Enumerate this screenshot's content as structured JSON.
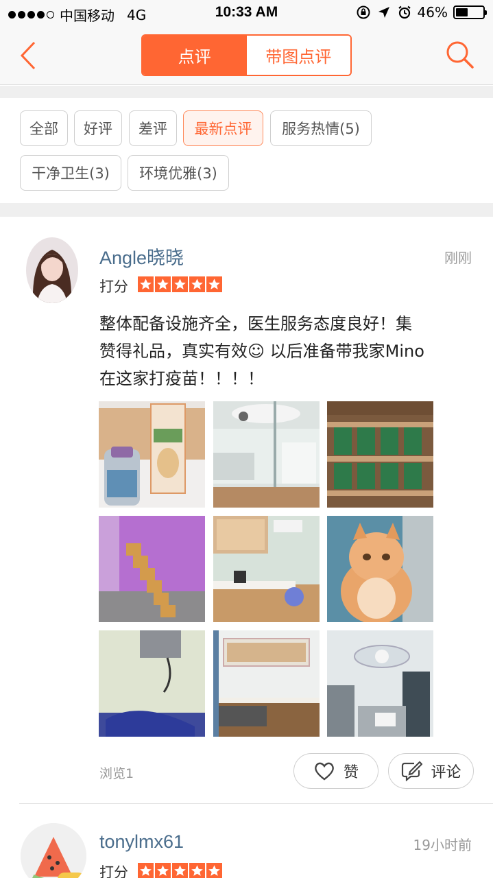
{
  "status_bar": {
    "carrier": "中国移动",
    "network": "4G",
    "time": "10:33 AM",
    "battery": "46%",
    "battery_level": 0.46
  },
  "nav": {
    "tabs": [
      {
        "label": "点评",
        "active": true
      },
      {
        "label": "带图点评",
        "active": false
      }
    ],
    "accent_color": "#ff6633"
  },
  "filters": [
    {
      "label": "全部",
      "active": false
    },
    {
      "label": "好评",
      "active": false
    },
    {
      "label": "差评",
      "active": false
    },
    {
      "label": "最新点评",
      "active": true
    },
    {
      "label": "服务热情(5)",
      "active": false
    },
    {
      "label": "干净卫生(3)",
      "active": false
    },
    {
      "label": "环境优雅(3)",
      "active": false
    }
  ],
  "reviews": [
    {
      "username": "Angle晓晓",
      "time": "刚刚",
      "rating_label": "打分",
      "rating": 5,
      "text_lines": [
        "整体配备设施齐全，医生服务态度良好！集",
        "赞得礼品，真实有效☺ 以后准备带我家Mino",
        "在这家打疫苗！！！！"
      ],
      "photos": [
        "medicine-bottles",
        "reception-desk",
        "pet-food-shelves",
        "purple-room-stairs",
        "clinic-counter",
        "orange-cat",
        "xray-room",
        "sink-cabinet",
        "operating-room"
      ],
      "views": "浏览1",
      "like_label": "赞",
      "comment_label": "评论"
    },
    {
      "username": "tonylmx61",
      "time": "19小时前",
      "rating_label": "打分",
      "rating": 5
    }
  ]
}
